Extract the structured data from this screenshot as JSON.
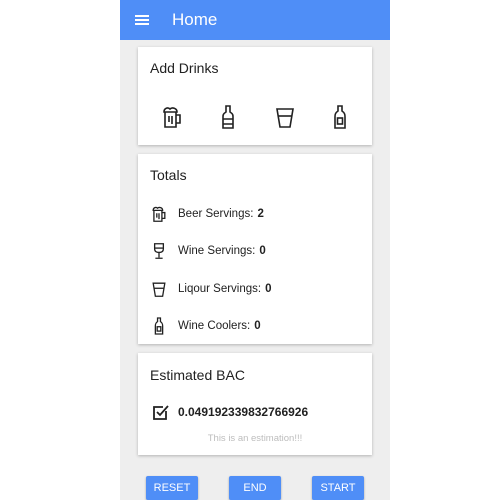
{
  "appbar": {
    "title": "Home",
    "menu_icon": "hamburger-menu-icon",
    "color": "#4f8ef7"
  },
  "add_drinks": {
    "title": "Add Drinks",
    "drinks": [
      {
        "icon": "beer-mug-icon"
      },
      {
        "icon": "wine-bottle-icon"
      },
      {
        "icon": "liquor-glass-icon"
      },
      {
        "icon": "wine-cooler-bottle-icon"
      }
    ]
  },
  "totals": {
    "title": "Totals",
    "rows": [
      {
        "label": "Beer Servings:",
        "value": "2",
        "icon": "beer-mug-icon"
      },
      {
        "label": "Wine Servings:",
        "value": "0",
        "icon": "wine-glass-icon"
      },
      {
        "label": "Liqour Servings:",
        "value": "0",
        "icon": "liquor-glass-icon"
      },
      {
        "label": "Wine Coolers:",
        "value": "0",
        "icon": "wine-cooler-bottle-icon"
      }
    ]
  },
  "bac": {
    "title": "Estimated BAC",
    "value": "0.049192339832766926",
    "icon": "checkbox-checked-icon",
    "note": "This is an estimation!!!"
  },
  "buttons": {
    "reset": "RESET",
    "end": "END",
    "start": "START"
  }
}
